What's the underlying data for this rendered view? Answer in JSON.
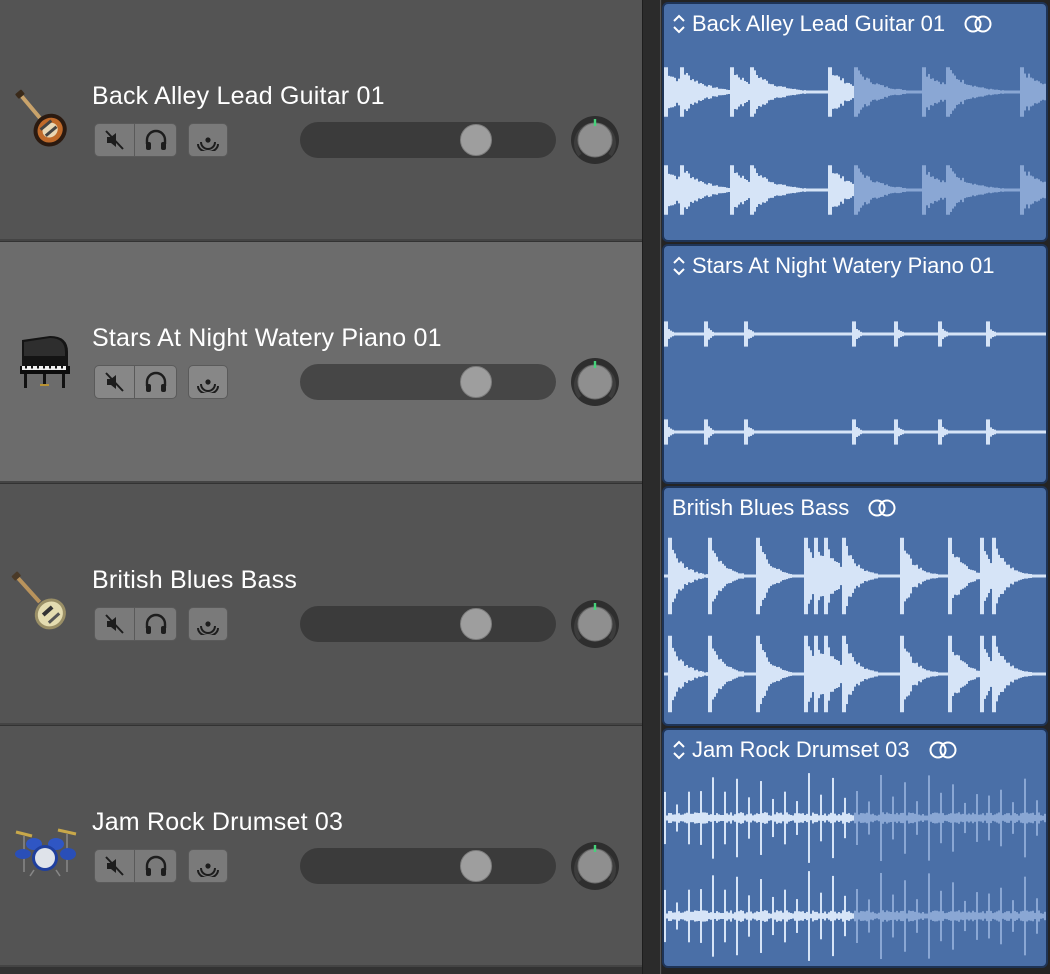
{
  "tracks": [
    {
      "name": "Back Alley Lead Guitar 01",
      "instrument_icon": "electric-guitar-icon",
      "selected": false,
      "volume": 0.72,
      "region": {
        "title": "Back Alley Lead Guitar 01",
        "has_updown": true,
        "has_loop": true
      }
    },
    {
      "name": "Stars At Night Watery Piano 01",
      "instrument_icon": "grand-piano-icon",
      "selected": true,
      "volume": 0.72,
      "region": {
        "title": "Stars At Night Watery Piano 01",
        "has_updown": true,
        "has_loop": false
      }
    },
    {
      "name": "British Blues Bass",
      "instrument_icon": "bass-guitar-icon",
      "selected": false,
      "volume": 0.72,
      "region": {
        "title": "British Blues Bass",
        "has_updown": false,
        "has_loop": true
      }
    },
    {
      "name": "Jam Rock Drumset 03",
      "instrument_icon": "drum-kit-icon",
      "selected": false,
      "volume": 0.72,
      "region": {
        "title": "Jam Rock Drumset 03",
        "has_updown": true,
        "has_loop": true
      }
    }
  ],
  "colors": {
    "region_fill": "#4a6fa7",
    "waveform": "#d6e4f7",
    "waveform_dim": "#8aa7d4"
  }
}
